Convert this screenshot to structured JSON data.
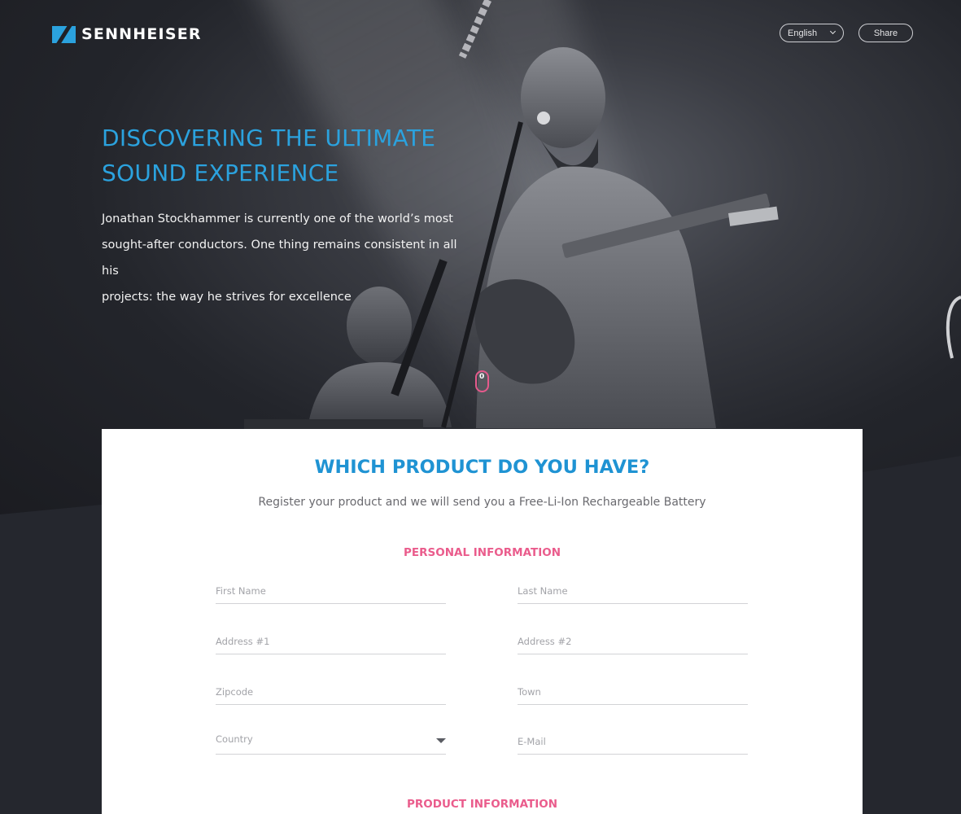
{
  "header": {
    "logo_text": "SENNHEISER",
    "language": "English",
    "share_label": "Share"
  },
  "hero": {
    "title_line1": "DISCOVERING THE ULTIMATE",
    "title_line2": "SOUND EXPERIENCE",
    "description_line1": "Jonathan Stockhammer is currently one of the world’s most",
    "description_line2": "sought-after conductors. One thing remains consistent in all his",
    "description_line3": "projects: the way he strives for excellence",
    "scroll_indicator": "0"
  },
  "form": {
    "title": "WHICH PRODUCT DO YOU HAVE?",
    "subtitle": "Register your product and we will send you a Free-Li-Ion Rechargeable Battery",
    "personal_heading": "PERSONAL INFORMATION",
    "product_heading": "PRODUCT INFORMATION",
    "fields": {
      "first_name": "First Name",
      "last_name": "Last Name",
      "address1": "Address #1",
      "address2": "Address #2",
      "zipcode": "Zipcode",
      "town": "Town",
      "country": "Country",
      "email": "E-Mail"
    }
  },
  "colors": {
    "brand_blue": "#2ba2de",
    "accent_pink": "#ea5c8c",
    "page_dark": "#25272e"
  }
}
